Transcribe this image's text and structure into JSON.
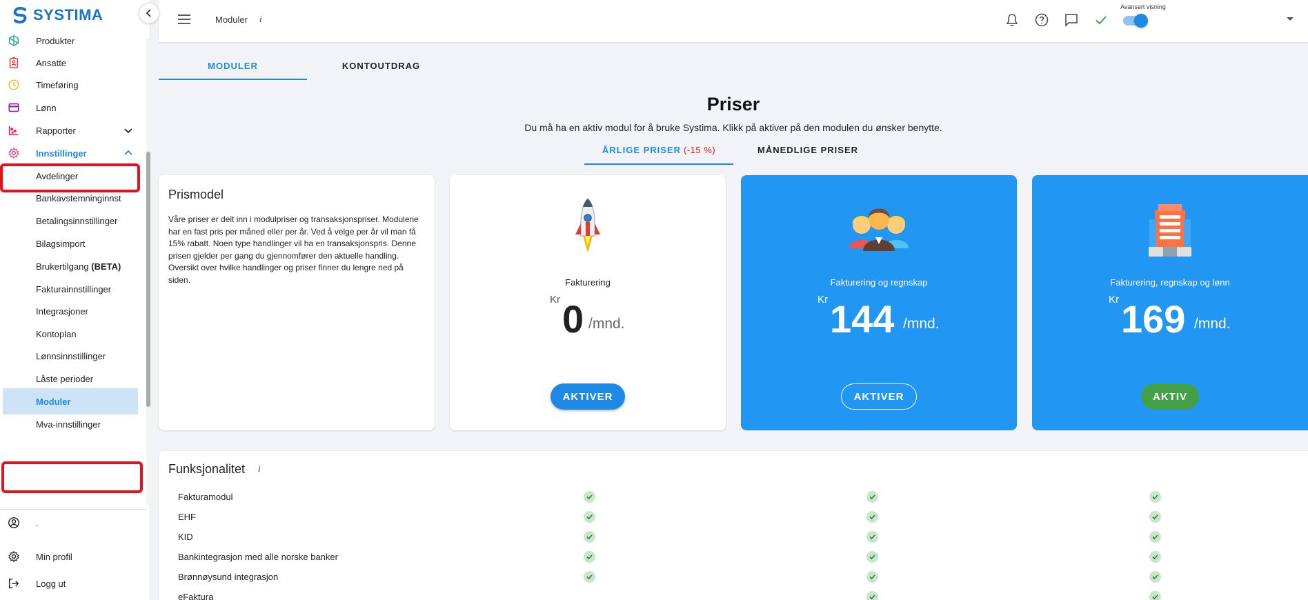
{
  "app": {
    "name": "SYSTIMA"
  },
  "sidebar": {
    "items": [
      {
        "label": "Produkter",
        "icon": "box-icon",
        "color": "#26a69a"
      },
      {
        "label": "Ansatte",
        "icon": "badge-icon",
        "color": "#e53935"
      },
      {
        "label": "Timeføring",
        "icon": "clock-icon",
        "color": "#fbc02d"
      },
      {
        "label": "Lønn",
        "icon": "card-icon",
        "color": "#8e24aa"
      },
      {
        "label": "Rapporter",
        "icon": "chart-icon",
        "color": "#e91e63"
      },
      {
        "label": "Innstillinger",
        "icon": "gear-icon",
        "color": "#ec407a"
      }
    ],
    "subitems": [
      {
        "label": "Avdelinger"
      },
      {
        "label": "Bankavstemninginnst"
      },
      {
        "label": "Betalingsinnstillinger"
      },
      {
        "label": "Bilagsimport"
      },
      {
        "label": "Brukertilgang",
        "suffix": "(BETA)"
      },
      {
        "label": "Fakturainnstillinger"
      },
      {
        "label": "Integrasjoner"
      },
      {
        "label": "Kontoplan"
      },
      {
        "label": "Lønnsinnstillinger"
      },
      {
        "label": "Låste perioder"
      },
      {
        "label": "Moduler"
      },
      {
        "label": "Mva-innstillinger"
      }
    ],
    "bottom": [
      {
        "label": ".",
        "icon": "user-circle-icon"
      },
      {
        "label": "Min profil",
        "icon": "gear-icon"
      },
      {
        "label": "Logg ut",
        "icon": "logout-icon"
      }
    ]
  },
  "topbar": {
    "page_label": "Moduler",
    "info": "i",
    "advanced_label": "Avansert visning",
    "advanced_on": true
  },
  "tabs": [
    {
      "label": "MODULER",
      "active": true
    },
    {
      "label": "KONTOUTDRAG",
      "active": false
    }
  ],
  "pricing": {
    "title": "Priser",
    "subtitle": "Du må ha en aktiv modul for å bruke Systima. Klikk på aktiver på den modulen du ønsker benytte.",
    "tab_yearly": "ÅRLIGE PRISER",
    "tab_yearly_discount": "(-15 %)",
    "tab_monthly": "MÅNEDLIGE PRISER"
  },
  "prismodel": {
    "title": "Prismodel",
    "text": "Våre priser er delt inn i modulpriser og transaksjonspriser. Modulene har en fast pris per måned eller per år. Ved å velge per år vil man få 15% rabatt. Noen type handlinger vil ha en transaksjonspris. Denne prisen gjelder per gang du gjennomfører den aktuelle handling. Oversikt over hvilke handlinger og priser finner du lengre ned på siden."
  },
  "plans": [
    {
      "name": "Fakturering",
      "currency": "Kr",
      "amount": "0",
      "per": "/mnd.",
      "button": "AKTIVER",
      "style": "white"
    },
    {
      "name": "Fakturering og regnskap",
      "currency": "Kr",
      "amount": "144",
      "per": "/mnd.",
      "button": "AKTIVER",
      "style": "blue"
    },
    {
      "name": "Fakturering, regnskap og lønn",
      "currency": "Kr",
      "amount": "169",
      "per": "/mnd.",
      "button": "AKTIV",
      "style": "blue-active"
    }
  ],
  "features": {
    "title": "Funksjonalitet",
    "info": "i",
    "rows": [
      {
        "label": "Fakturamodul",
        "plans": [
          true,
          true,
          true
        ]
      },
      {
        "label": "EHF",
        "plans": [
          true,
          true,
          true
        ]
      },
      {
        "label": "KID",
        "plans": [
          true,
          true,
          true
        ]
      },
      {
        "label": "Bankintegrasjon med alle norske banker",
        "plans": [
          true,
          true,
          true
        ]
      },
      {
        "label": "Brønnøysund integrasjon",
        "plans": [
          true,
          true,
          true
        ]
      },
      {
        "label": "eFaktura",
        "plans": [
          false,
          true,
          true
        ]
      }
    ]
  },
  "colors": {
    "accent": "#1e88e5",
    "card_blue": "#2196f3",
    "active_green": "#43a047",
    "highlight_red": "#e5121c"
  }
}
